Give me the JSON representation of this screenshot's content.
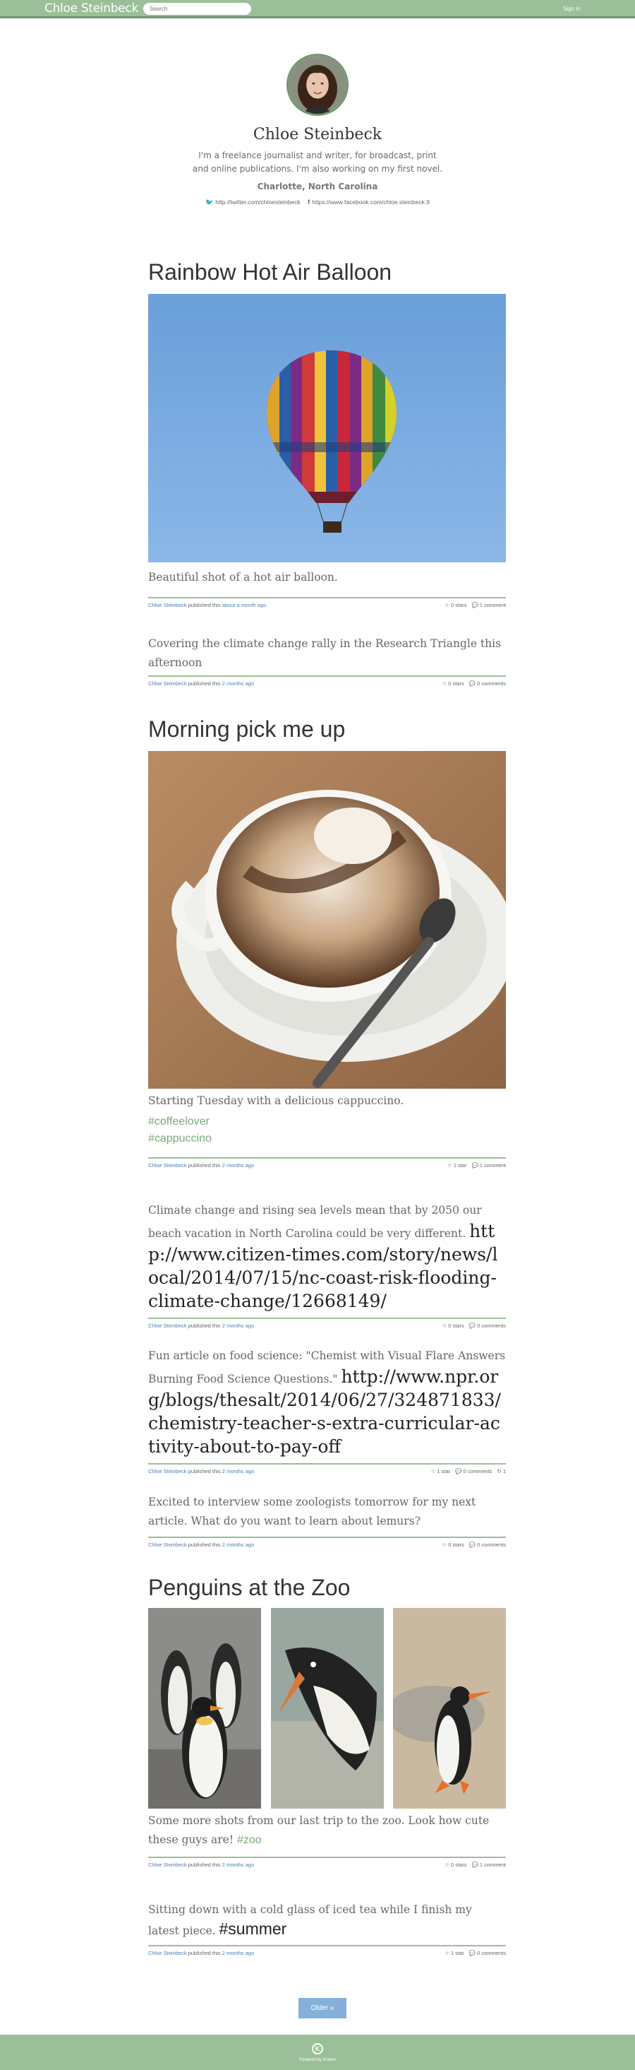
{
  "header": {
    "brand": "Chloe Steinbeck",
    "search_placeholder": "Search",
    "signin": "Sign in"
  },
  "profile": {
    "name": "Chloe Steinbeck",
    "bio": "I'm a freelance journalist and writer, for broadcast, print and online publications. I'm also working on my first novel.",
    "location": "Charlotte, North Carolina",
    "twitter": "http://twitter.com/chloesteinbeck",
    "facebook": "https://www.facebook.com/chloe.steinbeck.9"
  },
  "posts": [
    {
      "title": "Rainbow Hot Air Balloon",
      "body": "Beautiful shot of a hot air balloon.",
      "author": "Chloe Steinbeck",
      "published": "published this",
      "when": "about a month ago",
      "stars": "0 stars",
      "comments": "1 comment"
    },
    {
      "body": "Covering the climate change rally in the Research Triangle this afternoon",
      "author": "Chloe Steinbeck",
      "published": "published this",
      "when": "2 months ago",
      "stars": "0 stars",
      "comments": "0 comments"
    },
    {
      "title": "Morning pick me up",
      "body": "Starting Tuesday with a delicious cappuccino.",
      "tags": [
        "#coffeelover",
        "#cappuccino"
      ],
      "author": "Chloe Steinbeck",
      "published": "published this",
      "when": "2 months ago",
      "stars": "1 star",
      "comments": "1 comment"
    },
    {
      "body": "Climate change and rising sea levels mean that by 2050 our beach vacation in North Carolina could be very different.",
      "link": "http://www.citizen-times.com/story/news/local/2014/07/15/nc-coast-risk-flooding-climate-change/12668149/",
      "author": "Chloe Steinbeck",
      "published": "published this",
      "when": "2 months ago",
      "stars": "0 stars",
      "comments": "0 comments"
    },
    {
      "body": "Fun article on food science: \"Chemist with Visual Flare Answers Burning Food Science Questions.\"",
      "link": "http://www.npr.org/blogs/thesalt/2014/06/27/324871833/chemistry-teacher-s-extra-curricular-activity-about-to-pay-off",
      "author": "Chloe Steinbeck",
      "published": "published this",
      "when": "2 months ago",
      "stars": "1 star",
      "comments": "0 comments",
      "reposts": "1"
    },
    {
      "body": "Excited to interview some zoologists tomorrow for my next article. What do you want to learn about lemurs?",
      "author": "Chloe Steinbeck",
      "published": "published this",
      "when": "2 months ago",
      "stars": "0 stars",
      "comments": "0 comments"
    },
    {
      "title": "Penguins at the Zoo",
      "body": "Some more shots from our last trip to the zoo. Look how cute these guys are!",
      "tag": "#zoo",
      "author": "Chloe Steinbeck",
      "published": "published this",
      "when": "2 months ago",
      "stars": "0 stars",
      "comments": "1 comment"
    },
    {
      "body": "Sitting down with a cold glass of iced tea while I finish my latest piece.",
      "tag": "#summer",
      "author": "Chloe Steinbeck",
      "published": "published this",
      "when": "2 months ago",
      "stars": "1 star",
      "comments": "0 comments"
    }
  ],
  "pagination": {
    "older": "Older »"
  },
  "footer": {
    "logo": "K",
    "powered": "Powered by Known"
  },
  "icons": {
    "twitter": "twitter-icon",
    "facebook": "facebook-icon",
    "star": "star-icon",
    "comment": "comment-icon",
    "repost": "repost-icon"
  },
  "colors": {
    "header_green": "#9bbf98",
    "header_border": "#6f9870",
    "link_blue": "#4a7fb5",
    "tag_green": "#7aab75",
    "button_blue": "#85b0d9"
  }
}
